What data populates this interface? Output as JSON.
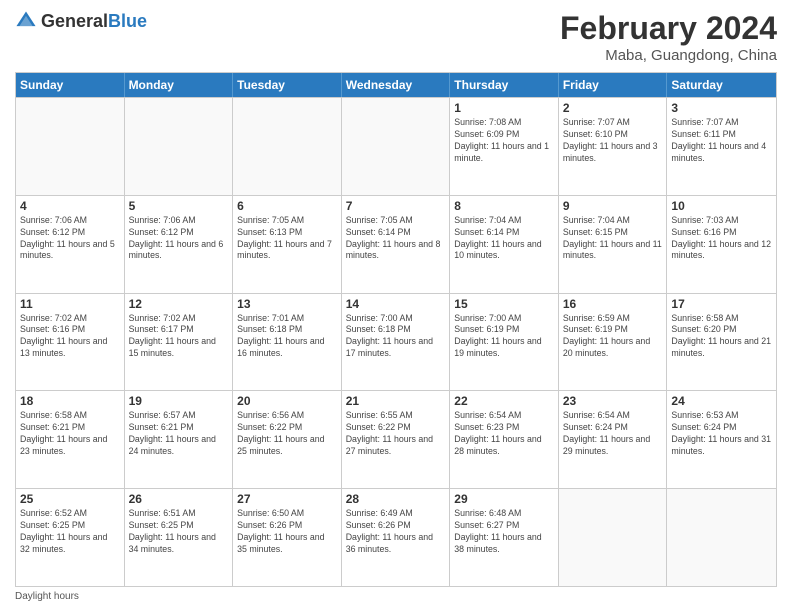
{
  "header": {
    "logo": {
      "general": "General",
      "blue": "Blue"
    },
    "month_year": "February 2024",
    "location": "Maba, Guangdong, China"
  },
  "weekdays": [
    "Sunday",
    "Monday",
    "Tuesday",
    "Wednesday",
    "Thursday",
    "Friday",
    "Saturday"
  ],
  "rows": [
    [
      {
        "day": "",
        "empty": true
      },
      {
        "day": "",
        "empty": true
      },
      {
        "day": "",
        "empty": true
      },
      {
        "day": "",
        "empty": true
      },
      {
        "day": "1",
        "sunrise": "7:08 AM",
        "sunset": "6:09 PM",
        "daylight": "11 hours and 1 minute."
      },
      {
        "day": "2",
        "sunrise": "7:07 AM",
        "sunset": "6:10 PM",
        "daylight": "11 hours and 3 minutes."
      },
      {
        "day": "3",
        "sunrise": "7:07 AM",
        "sunset": "6:11 PM",
        "daylight": "11 hours and 4 minutes."
      }
    ],
    [
      {
        "day": "4",
        "sunrise": "7:06 AM",
        "sunset": "6:12 PM",
        "daylight": "11 hours and 5 minutes."
      },
      {
        "day": "5",
        "sunrise": "7:06 AM",
        "sunset": "6:12 PM",
        "daylight": "11 hours and 6 minutes."
      },
      {
        "day": "6",
        "sunrise": "7:05 AM",
        "sunset": "6:13 PM",
        "daylight": "11 hours and 7 minutes."
      },
      {
        "day": "7",
        "sunrise": "7:05 AM",
        "sunset": "6:14 PM",
        "daylight": "11 hours and 8 minutes."
      },
      {
        "day": "8",
        "sunrise": "7:04 AM",
        "sunset": "6:14 PM",
        "daylight": "11 hours and 10 minutes."
      },
      {
        "day": "9",
        "sunrise": "7:04 AM",
        "sunset": "6:15 PM",
        "daylight": "11 hours and 11 minutes."
      },
      {
        "day": "10",
        "sunrise": "7:03 AM",
        "sunset": "6:16 PM",
        "daylight": "11 hours and 12 minutes."
      }
    ],
    [
      {
        "day": "11",
        "sunrise": "7:02 AM",
        "sunset": "6:16 PM",
        "daylight": "11 hours and 13 minutes."
      },
      {
        "day": "12",
        "sunrise": "7:02 AM",
        "sunset": "6:17 PM",
        "daylight": "11 hours and 15 minutes."
      },
      {
        "day": "13",
        "sunrise": "7:01 AM",
        "sunset": "6:18 PM",
        "daylight": "11 hours and 16 minutes."
      },
      {
        "day": "14",
        "sunrise": "7:00 AM",
        "sunset": "6:18 PM",
        "daylight": "11 hours and 17 minutes."
      },
      {
        "day": "15",
        "sunrise": "7:00 AM",
        "sunset": "6:19 PM",
        "daylight": "11 hours and 19 minutes."
      },
      {
        "day": "16",
        "sunrise": "6:59 AM",
        "sunset": "6:19 PM",
        "daylight": "11 hours and 20 minutes."
      },
      {
        "day": "17",
        "sunrise": "6:58 AM",
        "sunset": "6:20 PM",
        "daylight": "11 hours and 21 minutes."
      }
    ],
    [
      {
        "day": "18",
        "sunrise": "6:58 AM",
        "sunset": "6:21 PM",
        "daylight": "11 hours and 23 minutes."
      },
      {
        "day": "19",
        "sunrise": "6:57 AM",
        "sunset": "6:21 PM",
        "daylight": "11 hours and 24 minutes."
      },
      {
        "day": "20",
        "sunrise": "6:56 AM",
        "sunset": "6:22 PM",
        "daylight": "11 hours and 25 minutes."
      },
      {
        "day": "21",
        "sunrise": "6:55 AM",
        "sunset": "6:22 PM",
        "daylight": "11 hours and 27 minutes."
      },
      {
        "day": "22",
        "sunrise": "6:54 AM",
        "sunset": "6:23 PM",
        "daylight": "11 hours and 28 minutes."
      },
      {
        "day": "23",
        "sunrise": "6:54 AM",
        "sunset": "6:24 PM",
        "daylight": "11 hours and 29 minutes."
      },
      {
        "day": "24",
        "sunrise": "6:53 AM",
        "sunset": "6:24 PM",
        "daylight": "11 hours and 31 minutes."
      }
    ],
    [
      {
        "day": "25",
        "sunrise": "6:52 AM",
        "sunset": "6:25 PM",
        "daylight": "11 hours and 32 minutes."
      },
      {
        "day": "26",
        "sunrise": "6:51 AM",
        "sunset": "6:25 PM",
        "daylight": "11 hours and 34 minutes."
      },
      {
        "day": "27",
        "sunrise": "6:50 AM",
        "sunset": "6:26 PM",
        "daylight": "11 hours and 35 minutes."
      },
      {
        "day": "28",
        "sunrise": "6:49 AM",
        "sunset": "6:26 PM",
        "daylight": "11 hours and 36 minutes."
      },
      {
        "day": "29",
        "sunrise": "6:48 AM",
        "sunset": "6:27 PM",
        "daylight": "11 hours and 38 minutes."
      },
      {
        "day": "",
        "empty": true
      },
      {
        "day": "",
        "empty": true
      }
    ]
  ],
  "footer": {
    "label": "Daylight hours"
  }
}
